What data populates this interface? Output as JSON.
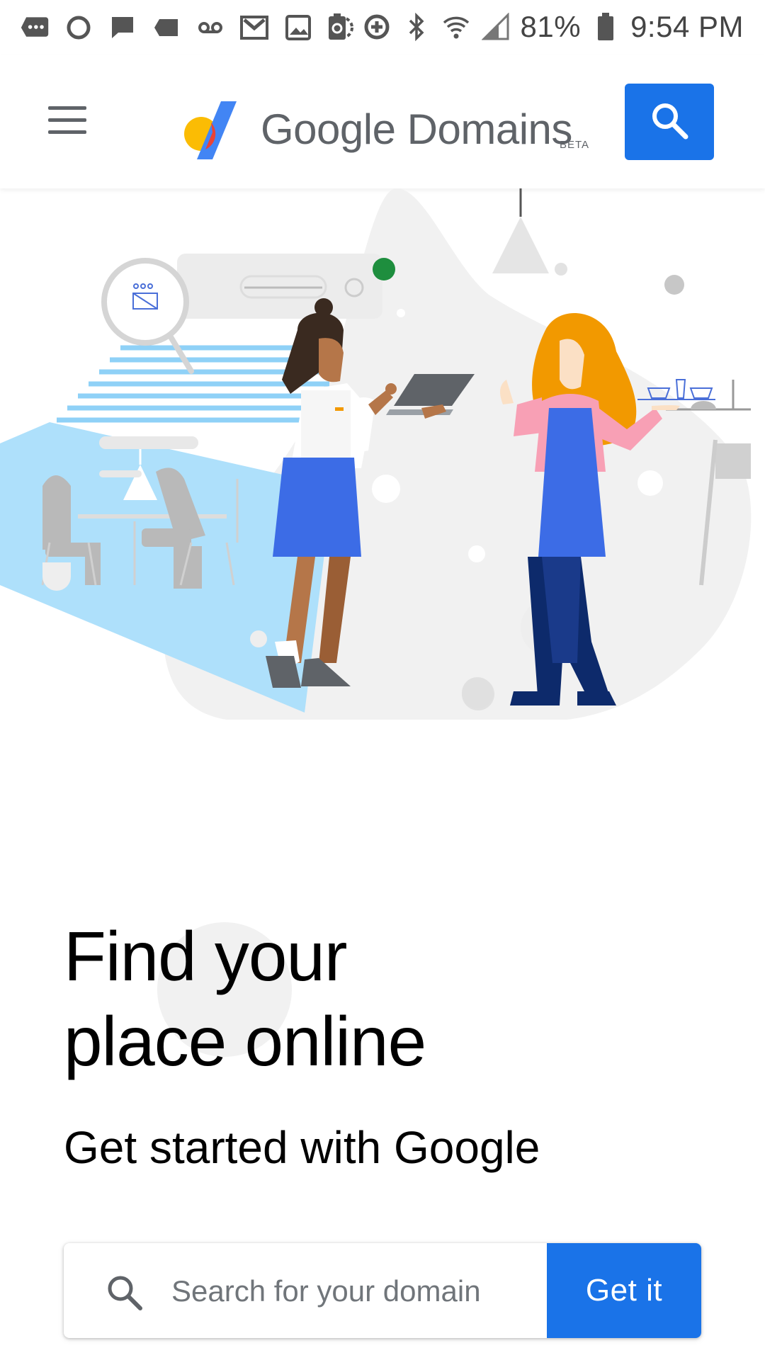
{
  "status_bar": {
    "battery_percent": "81%",
    "time": "9:54 PM",
    "left_icons": [
      "messages-icon",
      "circle-icon",
      "chat-icon",
      "tag-icon",
      "voicemail-icon",
      "gmail-icon",
      "gallery-icon",
      "sync-icon"
    ],
    "right_icons": [
      "battery-saver-icon",
      "data-saver-icon",
      "bluetooth-icon",
      "wifi-icon",
      "signal-icon",
      "battery-icon"
    ]
  },
  "header": {
    "brand_name": "Google Domains",
    "brand_badge": "BETA",
    "menu_icon": "hamburger-menu-icon",
    "search_icon": "search-icon"
  },
  "hero": {
    "illustration": "cafe-owners-illustration"
  },
  "main": {
    "headline_line1": "Find your",
    "headline_line2": "place online",
    "subheadline": "Get started with Google"
  },
  "domain_search": {
    "placeholder": "Search for your domain",
    "value": "",
    "button_label": "Get it"
  },
  "colors": {
    "accent": "#1a73e8",
    "text_primary": "#000000",
    "text_secondary": "#5f6368"
  }
}
